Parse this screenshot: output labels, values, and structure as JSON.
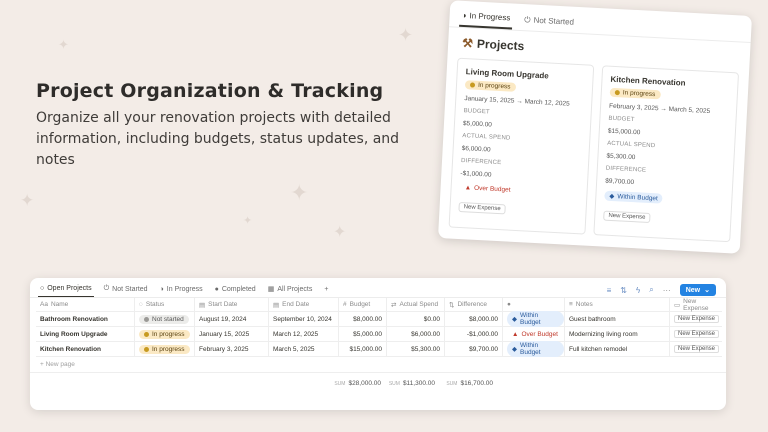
{
  "headline": {
    "title": "Project Organization & Tracking",
    "subtitle": "Organize all your renovation projects with detailed information, including budgets, status updates, and notes"
  },
  "card": {
    "tabs": [
      {
        "label": "In Progress",
        "icon": "progress-icon"
      },
      {
        "label": "Not Started",
        "icon": "power-icon"
      }
    ],
    "title": "Projects",
    "projects": [
      {
        "name": "Living Room Upgrade",
        "status": "In progress",
        "dates": "January 15, 2025 → March 12, 2025",
        "budget_label": "BUDGET",
        "budget": "$5,000.00",
        "spend_label": "ACTUAL SPEND",
        "spend": "$6,000.00",
        "diff_label": "DIFFERENCE",
        "diff": "-$1,000.00",
        "flag": "Over Budget",
        "button": "New Expense"
      },
      {
        "name": "Kitchen Renovation",
        "status": "In progress",
        "dates": "February 3, 2025 → March 5, 2025",
        "budget_label": "BUDGET",
        "budget": "$15,000.00",
        "spend_label": "ACTUAL SPEND",
        "spend": "$5,300.00",
        "diff_label": "DIFFERENCE",
        "diff": "$9,700.00",
        "flag": "Within Budget",
        "button": "New Expense"
      }
    ]
  },
  "db": {
    "tabs": [
      {
        "label": "Open Projects",
        "icon": "circle-icon"
      },
      {
        "label": "Not Started",
        "icon": "power-icon"
      },
      {
        "label": "In Progress",
        "icon": "progress-icon"
      },
      {
        "label": "Completed",
        "icon": "check-circle-icon"
      },
      {
        "label": "All Projects",
        "icon": "table-icon"
      }
    ],
    "new_label": "New",
    "columns": [
      "Name",
      "Status",
      "Start Date",
      "End Date",
      "Budget",
      "Actual Spend",
      "Difference",
      "",
      "Notes",
      "New Expense"
    ],
    "rows": [
      {
        "name": "Bathroom Renovation",
        "status": "Not started",
        "start": "August 19, 2024",
        "end": "September 10, 2024",
        "budget": "$8,000.00",
        "spend": "$0.00",
        "diff": "$8,000.00",
        "flag": "Within Budget",
        "notes": "Guest bathroom",
        "button": "New Expense"
      },
      {
        "name": "Living Room Upgrade",
        "status": "In progress",
        "start": "January 15, 2025",
        "end": "March 12, 2025",
        "budget": "$5,000.00",
        "spend": "$6,000.00",
        "diff": "-$1,000.00",
        "flag": "Over Budget",
        "notes": "Modernizing living room",
        "button": "New Expense"
      },
      {
        "name": "Kitchen Renovation",
        "status": "In progress",
        "start": "February 3, 2025",
        "end": "March 5, 2025",
        "budget": "$15,000.00",
        "spend": "$5,300.00",
        "diff": "$9,700.00",
        "flag": "Within Budget",
        "notes": "Full kitchen remodel",
        "button": "New Expense"
      }
    ],
    "new_page": "New page",
    "sum_label": "SUM",
    "sums": {
      "budget": "$28,000.00",
      "spend": "$11,300.00",
      "diff": "$16,700.00"
    }
  },
  "colors": {
    "background": "#f3ece7",
    "accent": "#2383e2",
    "in_progress": "#fbe9c4",
    "over": "#c0392b",
    "within": "#e3eefc"
  }
}
